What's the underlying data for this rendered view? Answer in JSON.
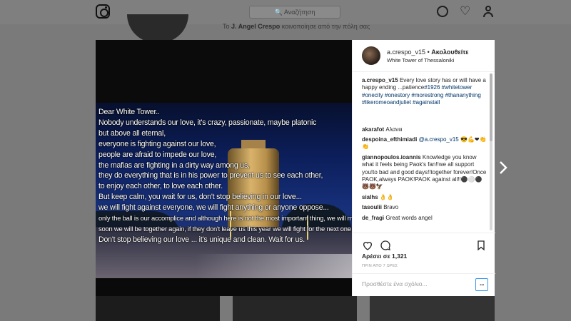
{
  "search": {
    "placeholder": "Αναζήτηση"
  },
  "profile": {
    "prefix": "Το",
    "name": "J. Angel Crespo",
    "suffix": "κοινοποίησε από την πόλη σας"
  },
  "post": {
    "username": "a.crespo_v15",
    "separator": "•",
    "follow_label": "Ακολουθείτε",
    "location": "White Tower of Thessaloniki",
    "caption_text": "Every love story has or will have a happy ending ...patience",
    "caption_tags": [
      "#1926",
      "#whitetower",
      "#onecity",
      "#onestory",
      "#morestrong",
      "#thananything",
      "#likeromeoandjuliet",
      "#againstall"
    ],
    "likes": "Αρέσει σε 1,321",
    "time": "ΠΡΙΝ ΑΠΟ 7 ΩΡΕΣ",
    "comment_placeholder": "Προσθέστε ένα σχόλιο...",
    "more_label": "..."
  },
  "comments": [
    {
      "user": "akarafot",
      "text": "Αλανιιι"
    },
    {
      "user": "despoina_efthimiadi",
      "mention": "@a.crespo_v15",
      "text": "😎💪❤👏👏"
    },
    {
      "user": "giannopoulos.ioannis",
      "text": "Knowledge you know what it feels being Paok's fan!!we all support you!to bad and good days!!together forever!Once PAOK,always PAOK!PAOK against all!!⚫⚪⚫🐻🐻🦅"
    },
    {
      "user": "sialhs",
      "text": "👌👌"
    },
    {
      "user": "tasoulii",
      "text": "Bravo"
    },
    {
      "user": "de_fragi",
      "text": "Great words angel"
    }
  ],
  "photo_text": [
    "Dear White Tower..",
    "Nobody understands our love, it's  crazy, passionate, maybe platonic",
    "but above all eternal,",
    "everyone is fighting against our love,",
    "people are afraid to impede our love,",
    "the mafias are fighting in a dirty way among us,",
    "they do everything that is in his power to prevent us to see each other,",
    "to enjoy each other, to love each other.",
    "But keep calm, you wait for us, don't stop believing in our love...",
    "we will fight against everyone, we will fight anything or anyone oppose...",
    "only the ball is our accomplice and although here is not the most important thing, we will make her to fight together with us.",
    "soon we will be together again, if they don't leave us this year we will fight for the next one to be with you.",
    "Don't stop believing our love ... it's unique and clean. Wait for us."
  ],
  "icons": [
    "instagram-logo-icon",
    "search-icon",
    "compass-icon",
    "heart-icon",
    "user-icon",
    "like-icon",
    "comment-icon",
    "bookmark-icon",
    "next-arrow-icon"
  ]
}
